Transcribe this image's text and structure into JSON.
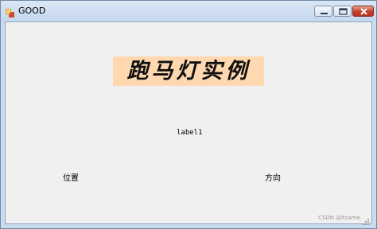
{
  "window": {
    "title": "GOOD",
    "icon": "windows-forms-app-icon",
    "controls": [
      "minimize-icon",
      "maximize-icon",
      "close-icon"
    ]
  },
  "form": {
    "banner_text": "跑马灯实例",
    "banner_bg": "#ffd8b0",
    "label1_text": "label1",
    "position_label": "位置",
    "direction_label": "方向",
    "background": "#f0f0f0"
  },
  "watermark": {
    "text": "CSDN @Itsame"
  }
}
